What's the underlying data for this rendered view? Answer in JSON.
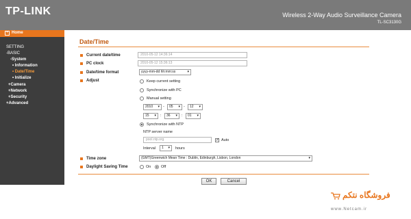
{
  "header": {
    "logo": "TP-LINK",
    "product_name": "Wireless 2-Way Audio Surveillance Camera",
    "model_number": "TL-SC3130G"
  },
  "sidebar": {
    "home_label": "Home",
    "items": [
      {
        "label": "SETTING"
      },
      {
        "label": "-BASIC"
      },
      {
        "label": "-System"
      },
      {
        "label": "• Information"
      },
      {
        "label": "• Date/Time"
      },
      {
        "label": "• Initialize"
      },
      {
        "label": "+Camera"
      },
      {
        "label": "+Network"
      },
      {
        "label": "+Security"
      },
      {
        "label": "+Advanced"
      }
    ]
  },
  "main": {
    "title": "Date/Time",
    "current_datetime": {
      "label": "Current date/time",
      "value": "2010-05-12   14:36:14"
    },
    "pc_clock": {
      "label": "PC clock",
      "value": "2010-05-12   15:36:13"
    },
    "datetime_format": {
      "label": "Date/time format",
      "value": "yyyy-mm-dd hh:mm:ss"
    },
    "adjust": {
      "label": "Adjust",
      "options": [
        "Keep current setting",
        "Synchronize with PC",
        "Manual setting",
        "Synchronize with NTP"
      ],
      "selected_index": 3,
      "manual_date": [
        "2010",
        "05",
        "12"
      ],
      "manual_time": [
        "15",
        "36",
        "01"
      ],
      "date_separator": "-",
      "time_separator": ":",
      "ntp_server_label": "NTP server name",
      "ntp_server_placeholder": "pool.ntp.org",
      "auto_label": "Auto",
      "auto_checked": true,
      "interval_label": "Interval",
      "interval_value": "1",
      "interval_unit": "hours"
    },
    "time_zone": {
      "label": "Time zone",
      "value": "(GMT)Greenwich Mean Time : Dublin, Edinburgh, Lisbon, London"
    },
    "daylight_saving": {
      "label": "Daylight Saving Time",
      "on_label": "On",
      "off_label": "Off",
      "selected": "Off"
    },
    "ok_label": "OK",
    "cancel_label": "Cancel"
  },
  "watermark": {
    "logo_text": "فروشگاه نتکم",
    "url": "www.Netcam.ir"
  },
  "colors": {
    "accent": "#e8761e",
    "header_bg": "#7a7a7a",
    "sidebar_bg": "#3d3d3d",
    "title": "#c15a10"
  }
}
